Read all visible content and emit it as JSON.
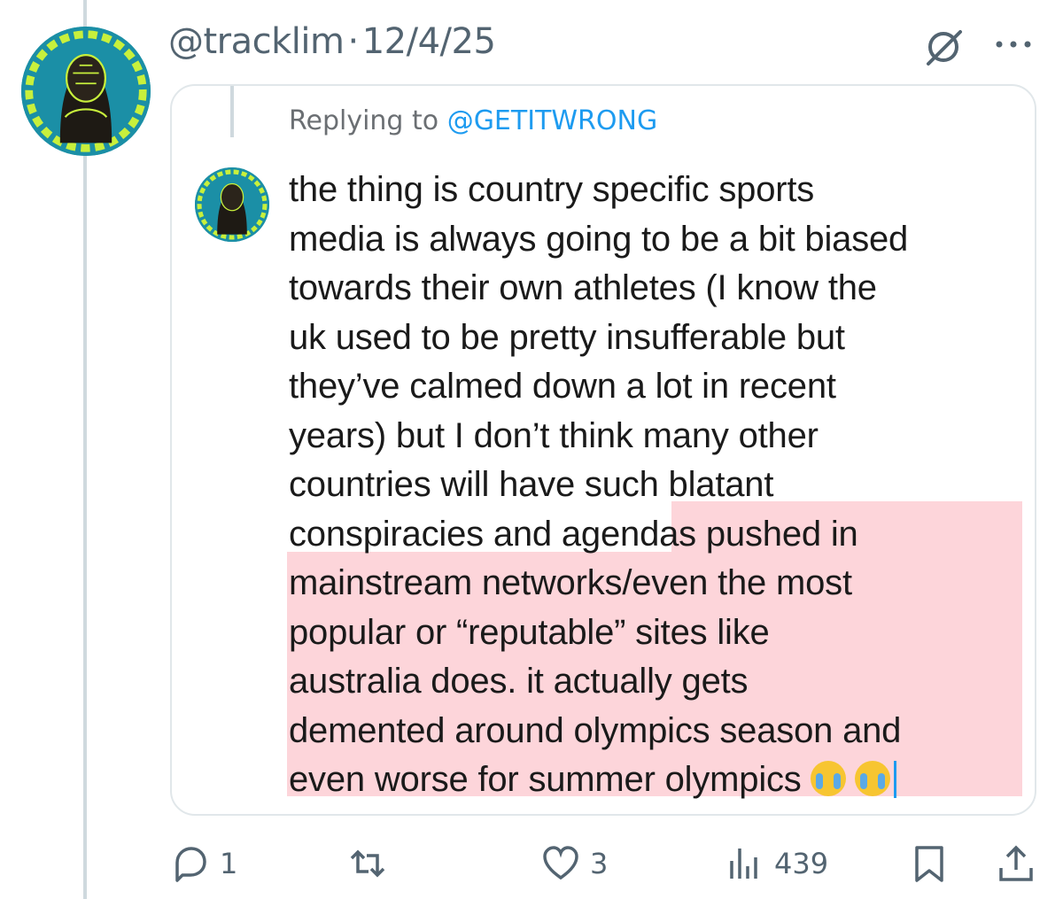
{
  "post": {
    "handle": "@tracklim",
    "separator": "·",
    "date": "12/4/25"
  },
  "quoted": {
    "replying_prefix": "Replying to",
    "replying_to": "@GETITWRONG",
    "lines": [
      "the thing is country specific sports",
      "media is always going to be a bit biased",
      "towards their own athletes (I know the",
      "uk used to be pretty insufferable but",
      "they’ve calmed down a lot in recent",
      "years) but I don’t think many other",
      "countries will have such blatant",
      "conspiracies and agendas pushed in",
      "mainstream networks/even the most",
      "popular or “reputable” sites like",
      "australia does. it actually gets",
      "demented around olympics season and",
      "even worse for summer olympics"
    ],
    "highlight_color": "#fdd5da",
    "emoji": [
      "loudly-crying-face",
      "loudly-crying-face"
    ]
  },
  "actions": {
    "replies": "1",
    "reposts": "",
    "likes": "3",
    "views": "439"
  },
  "colors": {
    "accent": "#1d9bf0",
    "muted": "#536471",
    "avatar_bg": "#1b8fa6",
    "avatar_lime": "#c8f03c"
  }
}
